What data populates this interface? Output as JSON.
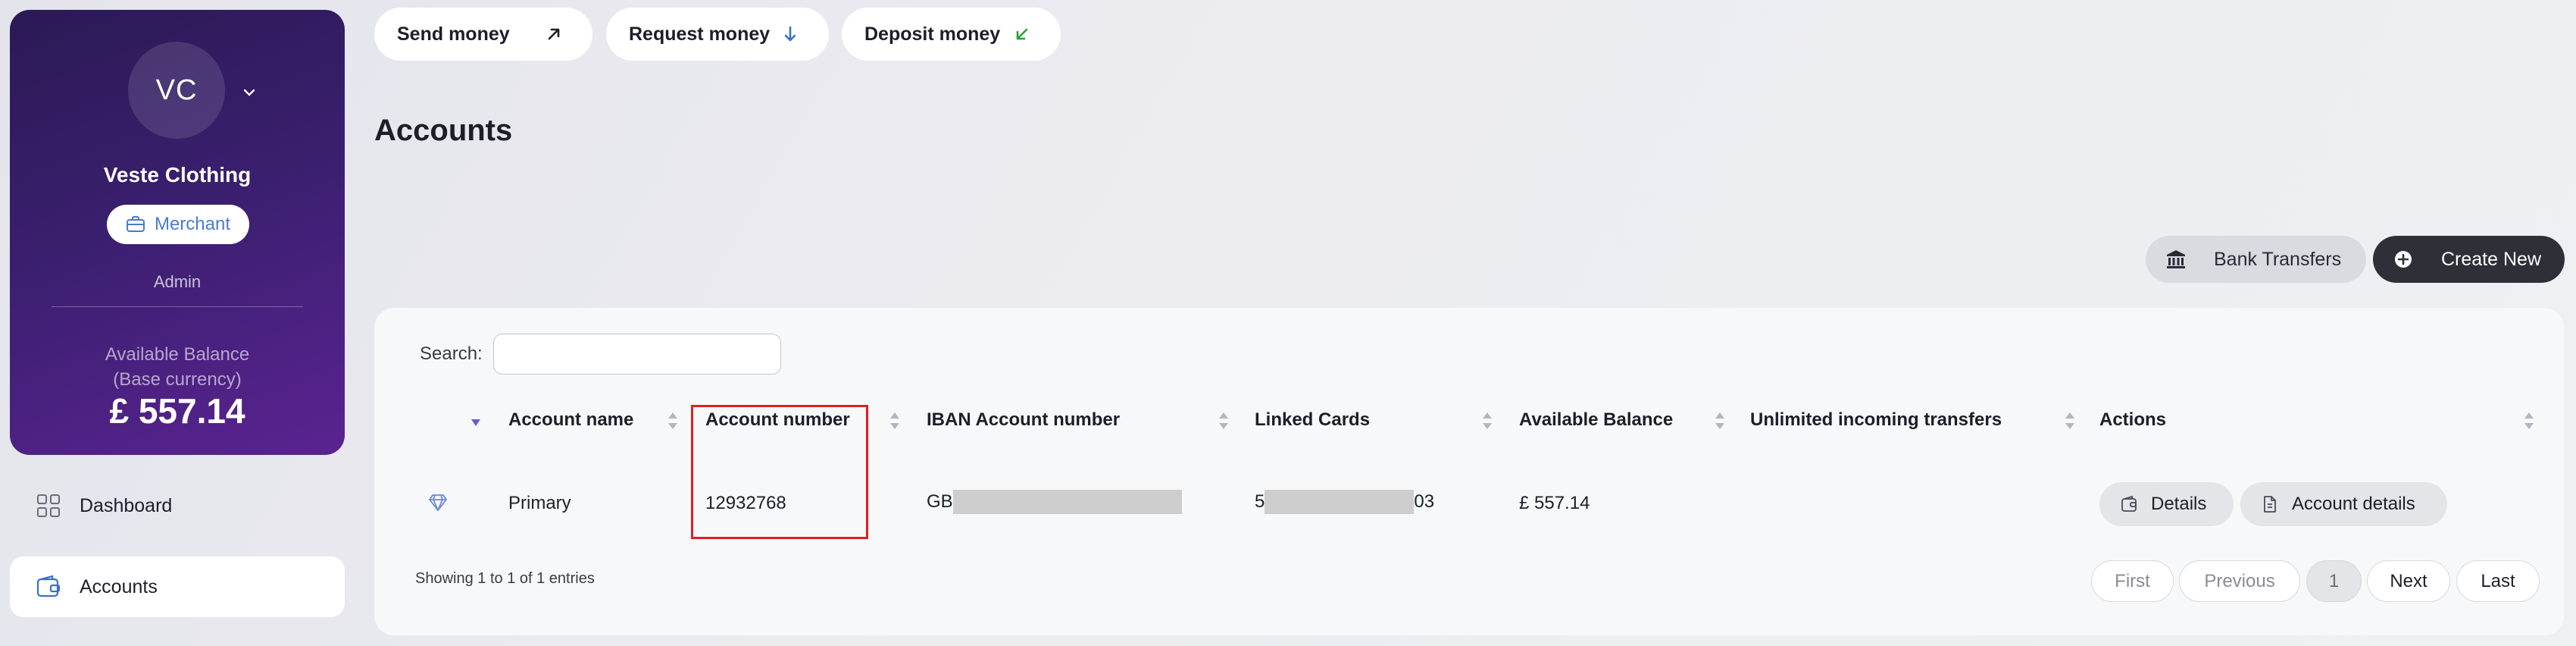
{
  "profile": {
    "initials": "VC",
    "company": "Veste Clothing",
    "badge": "Merchant",
    "role": "Admin",
    "balance_label_1": "Available Balance",
    "balance_label_2": "(Base currency)",
    "balance_value": "£ 557.14"
  },
  "nav": {
    "dashboard": "Dashboard",
    "accounts": "Accounts"
  },
  "quick_actions": {
    "send": "Send money",
    "request": "Request money",
    "deposit": "Deposit money"
  },
  "page": {
    "title": "Accounts",
    "bank_transfers": "Bank Transfers",
    "create_new": "Create New"
  },
  "search": {
    "label": "Search:",
    "value": ""
  },
  "table": {
    "columns": [
      "Account name",
      "Account number",
      "IBAN Account number",
      "Linked Cards",
      "Available Balance",
      "Unlimited incoming transfers",
      "Actions"
    ],
    "rows": [
      {
        "name": "Primary",
        "number": "12932768",
        "iban_prefix": "GB",
        "card_prefix": "5",
        "card_suffix": "03",
        "balance": "£ 557.14",
        "unlimited": "",
        "details": "Details",
        "account_details": "Account details"
      }
    ],
    "info": "Showing 1 to 1 of 1 entries"
  },
  "pagination": {
    "first": "First",
    "previous": "Previous",
    "current": "1",
    "next": "Next",
    "last": "Last"
  },
  "colors": {
    "accent_blue": "#4a7bd0",
    "deposit_green": "#2e9e3a",
    "highlight_red": "#e02020"
  }
}
